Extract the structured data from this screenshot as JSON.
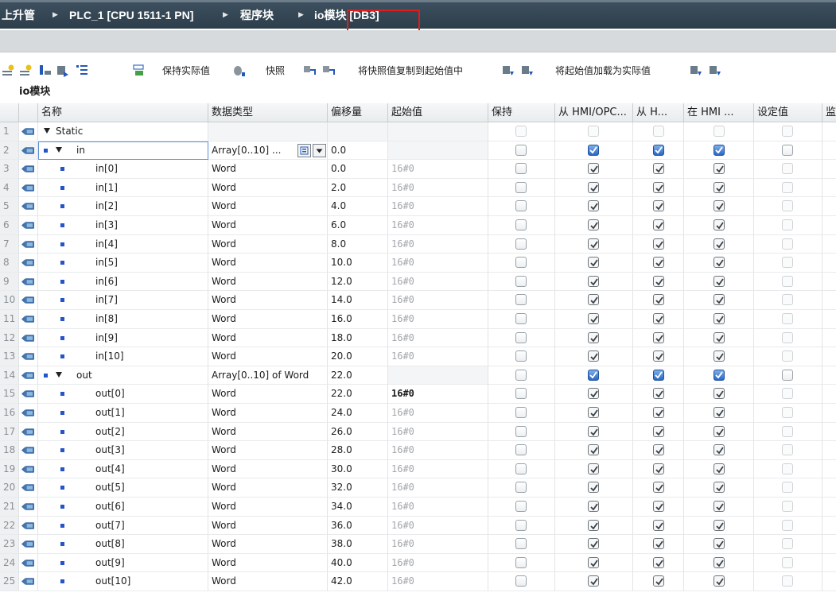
{
  "breadcrumb": {
    "items": [
      "上升管",
      "PLC_1 [CPU 1511-1 PN]",
      "程序块",
      "io模块 [DB3]"
    ]
  },
  "toolbar": {
    "keep_actual_label": "保持实际值",
    "snapshot_label": "快照",
    "copy_snapshot_label": "将快照值复制到起始值中",
    "load_start_label": "将起始值加载为实际值"
  },
  "db_name": "io模块",
  "headers": {
    "name": "名称",
    "datatype": "数据类型",
    "offset": "偏移量",
    "start": "起始值",
    "retain": "保持",
    "hmi_opc": "从 HMI/OPC...",
    "from_h": "从 H...",
    "in_hmi": "在 HMI ...",
    "setpoint": "设定值",
    "monitor": "监"
  },
  "rows": [
    {
      "num": "1",
      "name": "Static",
      "type": "",
      "offset": "",
      "start": ""
    },
    {
      "num": "2",
      "name": "in",
      "type": "Array[0..10] ...",
      "offset": "0.0",
      "start": ""
    },
    {
      "num": "3",
      "name": "in[0]",
      "type": "Word",
      "offset": "0.0",
      "start": "16#0"
    },
    {
      "num": "4",
      "name": "in[1]",
      "type": "Word",
      "offset": "2.0",
      "start": "16#0"
    },
    {
      "num": "5",
      "name": "in[2]",
      "type": "Word",
      "offset": "4.0",
      "start": "16#0"
    },
    {
      "num": "6",
      "name": "in[3]",
      "type": "Word",
      "offset": "6.0",
      "start": "16#0"
    },
    {
      "num": "7",
      "name": "in[4]",
      "type": "Word",
      "offset": "8.0",
      "start": "16#0"
    },
    {
      "num": "8",
      "name": "in[5]",
      "type": "Word",
      "offset": "10.0",
      "start": "16#0"
    },
    {
      "num": "9",
      "name": "in[6]",
      "type": "Word",
      "offset": "12.0",
      "start": "16#0"
    },
    {
      "num": "10",
      "name": "in[7]",
      "type": "Word",
      "offset": "14.0",
      "start": "16#0"
    },
    {
      "num": "11",
      "name": "in[8]",
      "type": "Word",
      "offset": "16.0",
      "start": "16#0"
    },
    {
      "num": "12",
      "name": "in[9]",
      "type": "Word",
      "offset": "18.0",
      "start": "16#0"
    },
    {
      "num": "13",
      "name": "in[10]",
      "type": "Word",
      "offset": "20.0",
      "start": "16#0"
    },
    {
      "num": "14",
      "name": "out",
      "type": "Array[0..10] of Word",
      "offset": "22.0",
      "start": ""
    },
    {
      "num": "15",
      "name": "out[0]",
      "type": "Word",
      "offset": "22.0",
      "start": "16#0"
    },
    {
      "num": "16",
      "name": "out[1]",
      "type": "Word",
      "offset": "24.0",
      "start": "16#0"
    },
    {
      "num": "17",
      "name": "out[2]",
      "type": "Word",
      "offset": "26.0",
      "start": "16#0"
    },
    {
      "num": "18",
      "name": "out[3]",
      "type": "Word",
      "offset": "28.0",
      "start": "16#0"
    },
    {
      "num": "19",
      "name": "out[4]",
      "type": "Word",
      "offset": "30.0",
      "start": "16#0"
    },
    {
      "num": "20",
      "name": "out[5]",
      "type": "Word",
      "offset": "32.0",
      "start": "16#0"
    },
    {
      "num": "21",
      "name": "out[6]",
      "type": "Word",
      "offset": "34.0",
      "start": "16#0"
    },
    {
      "num": "22",
      "name": "out[7]",
      "type": "Word",
      "offset": "36.0",
      "start": "16#0"
    },
    {
      "num": "23",
      "name": "out[8]",
      "type": "Word",
      "offset": "38.0",
      "start": "16#0"
    },
    {
      "num": "24",
      "name": "out[9]",
      "type": "Word",
      "offset": "40.0",
      "start": "16#0"
    },
    {
      "num": "25",
      "name": "out[10]",
      "type": "Word",
      "offset": "42.0",
      "start": "16#0"
    }
  ],
  "colors": {
    "title_bar": "#2d3e4b",
    "highlight": "#e21b1b",
    "checkbox_selected": "#2966c4"
  }
}
